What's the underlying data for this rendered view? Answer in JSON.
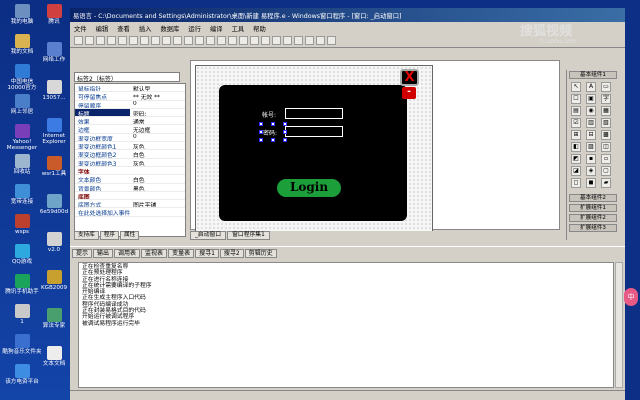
{
  "desktop": {
    "icons": [
      {
        "label": "我的电脑",
        "color": "#6d8fbf"
      },
      {
        "label": "我的文档",
        "color": "#d9b34f"
      },
      {
        "label": "中国电信10000官方",
        "color": "#2f7bd6"
      },
      {
        "label": "网上邻居",
        "color": "#4a7ec9"
      },
      {
        "label": "Yahoo! Messenger",
        "color": "#7a3fb8"
      },
      {
        "label": "回收站",
        "color": "#9db6cf"
      },
      {
        "label": "宽带连接",
        "color": "#3f8fd8"
      },
      {
        "label": "wsps",
        "color": "#bd3f2e"
      },
      {
        "label": "QQ游戏",
        "color": "#2ea9e0"
      },
      {
        "label": "腾讯手机助手",
        "color": "#1aa35a"
      },
      {
        "label": "1",
        "color": "#c9c9c9"
      },
      {
        "label": "酷狗音乐文件夹",
        "color": "#3a6fd0"
      },
      {
        "label": "该方电资平台",
        "color": "#3d8ee3"
      }
    ],
    "icons_col2": [
      {
        "label": "腾讯",
        "color": "#d04040"
      },
      {
        "label": "网络工作",
        "color": "#5a7fcf"
      },
      {
        "label": "13057...",
        "color": "#d8d8d8"
      },
      {
        "label": "Internet Explorer",
        "color": "#3c7be3"
      },
      {
        "label": "wsr1工具",
        "color": "#c95a2a"
      },
      {
        "label": "6e59d00d",
        "color": "#6fa4c9"
      },
      {
        "label": "v2.0",
        "color": "#d3d3d3"
      },
      {
        "label": "KGB2009",
        "color": "#c8a030"
      },
      {
        "label": "算法专家",
        "color": "#4a9f6f"
      },
      {
        "label": "文本文档",
        "color": "#ededed"
      }
    ]
  },
  "window": {
    "title": "易语言 - C:\\Documents and Settings\\Administrator\\桌面\\新建 易程序.e - Windows窗口程序 - [窗口: _启动窗口]"
  },
  "menu": [
    "文件",
    "编辑",
    "查看",
    "插入",
    "数据库",
    "运行",
    "编译",
    "工具",
    "帮助"
  ],
  "properties": {
    "combo_value": "标签2（标签）",
    "rows": [
      {
        "k": "鼠标指针",
        "v": "默认型",
        "type": "normal"
      },
      {
        "k": "可停留焦点",
        "v": "** 无效 **",
        "type": "normal"
      },
      {
        "k": "停留顺序",
        "v": "0",
        "type": "normal"
      },
      {
        "k": "标题",
        "v": "密码:",
        "type": "sel"
      },
      {
        "k": "效果",
        "v": "通常",
        "type": "normal"
      },
      {
        "k": "边框",
        "v": "无边框",
        "type": "normal"
      },
      {
        "k": "  渐变边框宽度",
        "v": "0",
        "type": "normal"
      },
      {
        "k": "  渐变边框颜色1",
        "v": "灰色",
        "type": "normal"
      },
      {
        "k": "  渐变边框颜色2",
        "v": "白色",
        "type": "normal"
      },
      {
        "k": "  渐变边框颜色3",
        "v": "灰色",
        "type": "normal"
      },
      {
        "k": "字体",
        "v": "",
        "type": "grp"
      },
      {
        "k": "文本颜色",
        "v": "白色",
        "type": "normal"
      },
      {
        "k": "背景颜色",
        "v": "黑色",
        "type": "normal"
      },
      {
        "k": "底图",
        "v": "",
        "type": "grp"
      },
      {
        "k": "  底图方式",
        "v": "图片平铺",
        "type": "normal"
      },
      {
        "k": "在此处选择加入事件处理子程序",
        "v": "",
        "type": "normal"
      }
    ],
    "tabs": [
      "支持库",
      "程序",
      "属性"
    ]
  },
  "designer": {
    "close_glyph": "X",
    "min_glyph": "-",
    "account_label": "帐号:",
    "password_label": "密码:",
    "login_label": "Login",
    "tabs": [
      "_启动窗口",
      "窗口程序集1"
    ]
  },
  "toolbox": {
    "header1": "基本组件1",
    "header2": "基本组件2",
    "groups": [
      "扩展组件1",
      "扩展组件2",
      "扩展组件3"
    ]
  },
  "output": {
    "tabs": [
      "提示",
      "输出",
      "调用表",
      "监视表",
      "变量表",
      "搜寻1",
      "搜寻2",
      "剪辑历史"
    ],
    "lines": [
      "正在检查重复名称",
      "正在预处理程序",
      "正在进行名称连接",
      "正在统计需要编译的子程序",
      "开始编译",
      "正在生成主程序入口代码",
      "程序代码编译成功",
      "正在封装易格式目的代码",
      "开始运行被调试程序",
      "被调试易程序运行完毕"
    ]
  },
  "watermark": {
    "line1": "搜狐视频",
    "line2": "tv.sohu.com"
  }
}
